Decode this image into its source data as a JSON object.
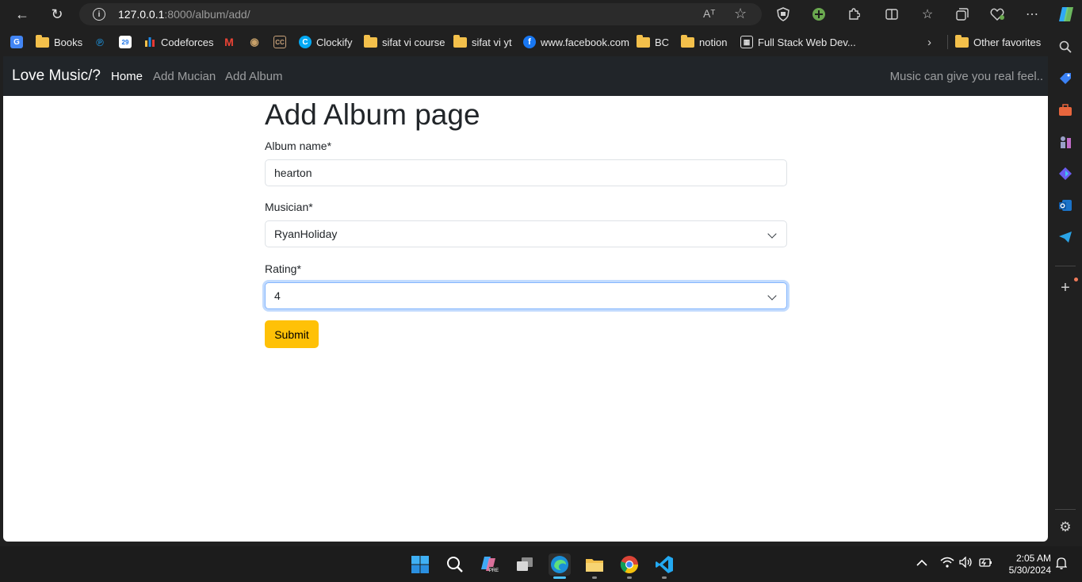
{
  "browser": {
    "url_host": "127.0.0.1",
    "url_rest": ":8000/album/add/",
    "read_aloud_label": "Aᵀ"
  },
  "bookmarks": [
    {
      "label": "",
      "icon": "google-translate-icon"
    },
    {
      "label": "Books",
      "icon": "folder-icon"
    },
    {
      "label": "",
      "icon": "tinkercad-icon"
    },
    {
      "label": "",
      "icon": "calendar-icon"
    },
    {
      "label": "Codeforces",
      "icon": "codeforces-icon"
    },
    {
      "label": "",
      "icon": "gmail-icon"
    },
    {
      "label": "",
      "icon": "codechef-icon"
    },
    {
      "label": "",
      "icon": "cc-icon"
    },
    {
      "label": "Clockify",
      "icon": "clockify-icon"
    },
    {
      "label": "sifat vi course",
      "icon": "folder-icon"
    },
    {
      "label": "sifat vi yt",
      "icon": "folder-icon"
    },
    {
      "label": "www.facebook.com",
      "icon": "facebook-icon"
    },
    {
      "label": "BC",
      "icon": "folder-icon"
    },
    {
      "label": "notion",
      "icon": "folder-icon"
    },
    {
      "label": "Full Stack Web Dev...",
      "icon": "grid-icon"
    },
    {
      "label": "Other favorites",
      "icon": "folder-icon"
    }
  ],
  "navbar": {
    "brand": "Love Music/?",
    "links": [
      "Home",
      "Add Mucian",
      "Add Album"
    ],
    "tagline": "Music can give you real feel.."
  },
  "form": {
    "title": "Add Album page",
    "album_name_label": "Album name*",
    "album_name_value": "hearton",
    "musician_label": "Musician*",
    "musician_value": "RyanHoliday",
    "rating_label": "Rating*",
    "rating_value": "4",
    "submit_label": "Submit"
  },
  "taskbar": {
    "time": "2:05 AM",
    "date": "5/30/2024"
  },
  "colors": {
    "navbar_bg": "#212529",
    "submit_bg": "#ffc107",
    "focus_border": "#86b7fe"
  }
}
